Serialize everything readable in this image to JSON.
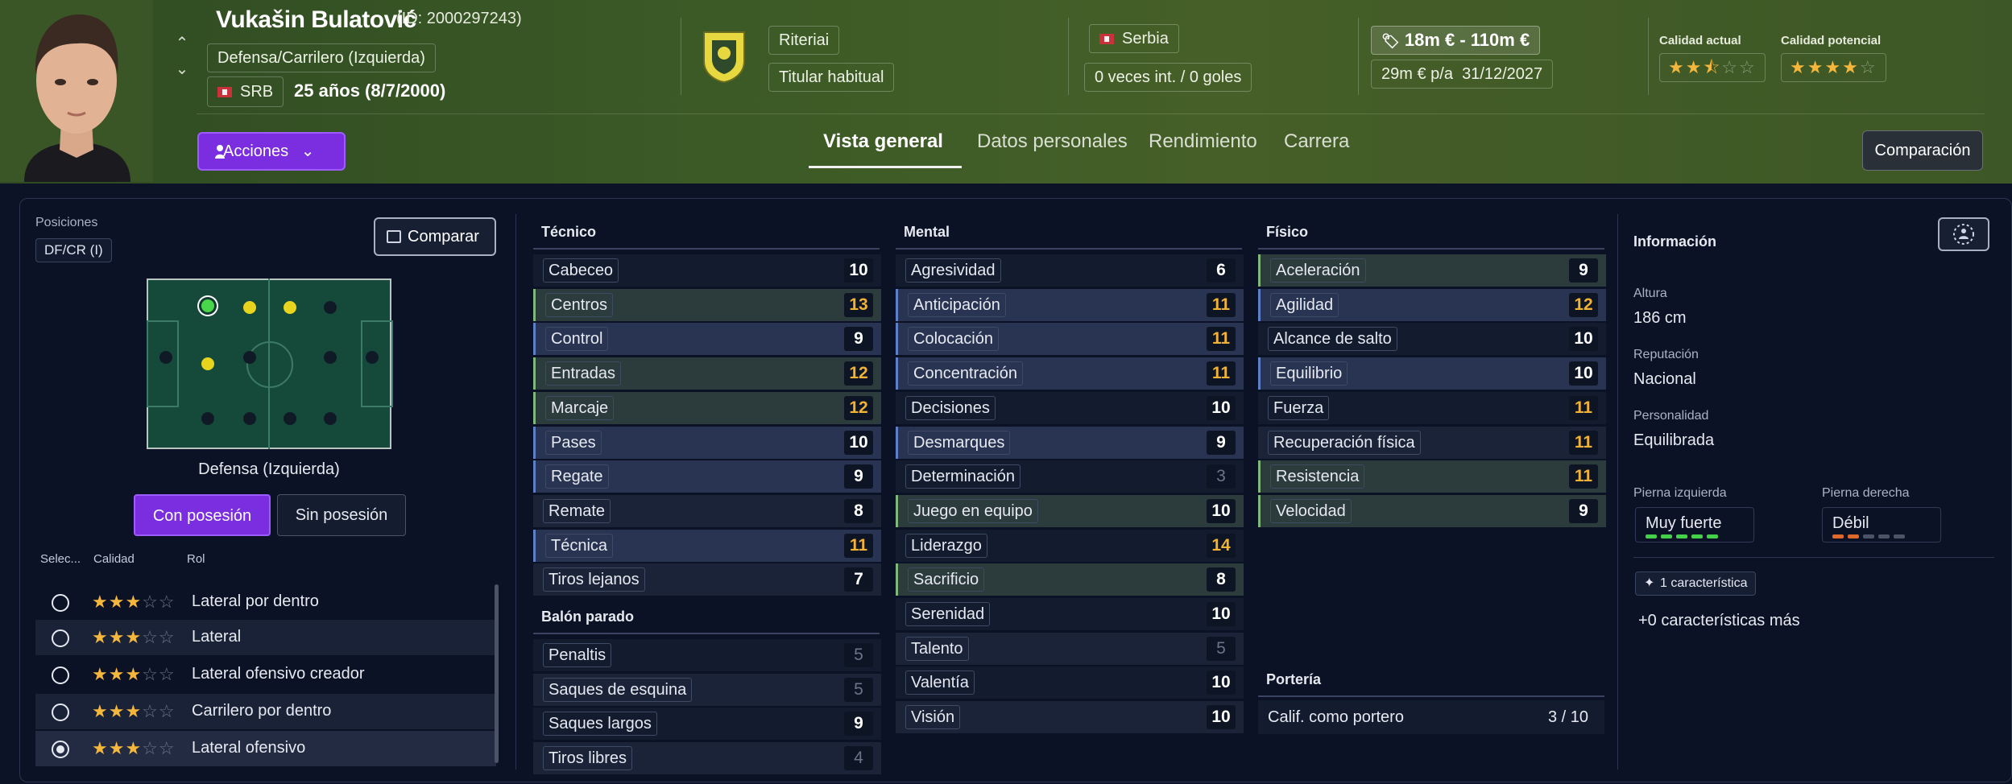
{
  "player": {
    "name": "Vukašin Bulatović",
    "id": "(ID: 2000297243)",
    "position": "Defensa/Carrilero (Izquierda)",
    "nation_code": "SRB",
    "age": "25 años (8/7/2000)"
  },
  "club": {
    "name": "Riteriai",
    "status": "Titular habitual"
  },
  "nation": {
    "name": "Serbia",
    "caps": "0 veces int. / 0 goles"
  },
  "value": {
    "range": "18m € - 110m €",
    "wage": "29m € p/a",
    "contract_end": "31/12/2027"
  },
  "quality": {
    "current_label": "Calidad actual",
    "current_stars": 2.5,
    "potential_label": "Calidad potencial",
    "potential_stars": 4
  },
  "actions_label": "Acciones",
  "tabs": [
    "Vista general",
    "Datos personales",
    "Rendimiento",
    "Carrera"
  ],
  "active_tab": "Vista general",
  "compare_top": "Comparación",
  "left": {
    "positions_label": "Posiciones",
    "position_chip": "DF/CR (I)",
    "compare_btn": "Comparar",
    "role_name": "Defensa (Izquierda)",
    "with_possession": "Con posesión",
    "without_possession": "Sin posesión",
    "col_select": "Selec...",
    "col_quality": "Calidad",
    "col_role": "Rol",
    "roles": [
      {
        "name": "Lateral por dentro",
        "stars": 3,
        "selected": false
      },
      {
        "name": "Lateral",
        "stars": 3,
        "selected": false
      },
      {
        "name": "Lateral ofensivo creador",
        "stars": 3,
        "selected": false
      },
      {
        "name": "Carrilero por dentro",
        "stars": 3,
        "selected": false
      },
      {
        "name": "Lateral ofensivo",
        "stars": 3,
        "selected": true
      }
    ]
  },
  "tecnico": {
    "title": "Técnico",
    "attrs": [
      {
        "name": "Cabeceo",
        "value": 10
      },
      {
        "name": "Centros",
        "value": 13
      },
      {
        "name": "Control",
        "value": 9
      },
      {
        "name": "Entradas",
        "value": 12
      },
      {
        "name": "Marcaje",
        "value": 12
      },
      {
        "name": "Pases",
        "value": 10
      },
      {
        "name": "Regate",
        "value": 9
      },
      {
        "name": "Remate",
        "value": 8
      },
      {
        "name": "Técnica",
        "value": 11
      },
      {
        "name": "Tiros lejanos",
        "value": 7
      }
    ]
  },
  "balon_parado": {
    "title": "Balón parado",
    "attrs": [
      {
        "name": "Penaltis",
        "value": 5
      },
      {
        "name": "Saques de esquina",
        "value": 5
      },
      {
        "name": "Saques largos",
        "value": 9
      },
      {
        "name": "Tiros libres",
        "value": 4
      }
    ]
  },
  "mental": {
    "title": "Mental",
    "attrs": [
      {
        "name": "Agresividad",
        "value": 6
      },
      {
        "name": "Anticipación",
        "value": 11
      },
      {
        "name": "Colocación",
        "value": 11
      },
      {
        "name": "Concentración",
        "value": 11
      },
      {
        "name": "Decisiones",
        "value": 10
      },
      {
        "name": "Desmarques",
        "value": 9
      },
      {
        "name": "Determinación",
        "value": 3
      },
      {
        "name": "Juego en equipo",
        "value": 10
      },
      {
        "name": "Liderazgo",
        "value": 14
      },
      {
        "name": "Sacrificio",
        "value": 8
      },
      {
        "name": "Serenidad",
        "value": 10
      },
      {
        "name": "Talento",
        "value": 5
      },
      {
        "name": "Valentía",
        "value": 10
      },
      {
        "name": "Visión",
        "value": 10
      }
    ]
  },
  "fisico": {
    "title": "Físico",
    "attrs": [
      {
        "name": "Aceleración",
        "value": 9
      },
      {
        "name": "Agilidad",
        "value": 12
      },
      {
        "name": "Alcance de salto",
        "value": 10
      },
      {
        "name": "Equilibrio",
        "value": 10
      },
      {
        "name": "Fuerza",
        "value": 11
      },
      {
        "name": "Recuperación física",
        "value": 11
      },
      {
        "name": "Resistencia",
        "value": 11
      },
      {
        "name": "Velocidad",
        "value": 9
      }
    ]
  },
  "porteria": {
    "title": "Portería",
    "label": "Calif. como portero",
    "value": "3 / 10"
  },
  "info": {
    "title": "Información",
    "height_label": "Altura",
    "height": "186 cm",
    "reputation_label": "Reputación",
    "reputation": "Nacional",
    "personality_label": "Personalidad",
    "personality": "Equilibrada",
    "left_foot_label": "Pierna izquierda",
    "left_foot": "Muy fuerte",
    "left_foot_level": 5,
    "right_foot_label": "Pierna derecha",
    "right_foot": "Débil",
    "right_foot_level": 2,
    "traits_count": "1 característica",
    "traits_more": "+0 características más"
  },
  "colors": {
    "accent_purple": "#7a2ee0",
    "highlight_orange": "#f2b233",
    "star_gold": "#f4b63c",
    "good_green": "#45d04a"
  }
}
